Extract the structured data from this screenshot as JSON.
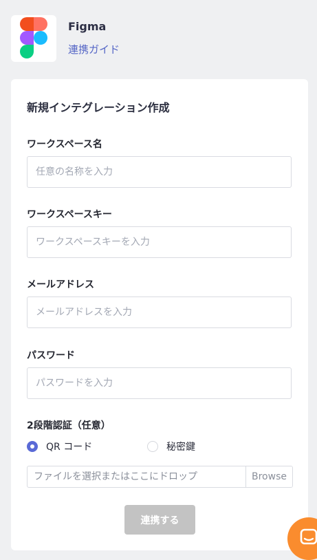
{
  "app": {
    "name": "Figma",
    "guide_link": "連携ガイド",
    "logo_colors": [
      "#f24e1e",
      "#ff7262",
      "#a259ff",
      "#1abcfe",
      "#0acf83"
    ]
  },
  "form": {
    "title": "新規インテグレーション作成",
    "fields": [
      {
        "label": "ワークスペース名",
        "placeholder": "任意の名称を入力",
        "value": ""
      },
      {
        "label": "ワークスペースキー",
        "placeholder": "ワークスペースキーを入力",
        "value": ""
      },
      {
        "label": "メールアドレス",
        "placeholder": "メールアドレスを入力",
        "value": ""
      },
      {
        "label": "パスワード",
        "placeholder": "パスワードを入力",
        "value": ""
      }
    ],
    "two_factor": {
      "label": "2段階認証（任意）",
      "options": [
        {
          "label": "QR コード",
          "selected": true
        },
        {
          "label": "秘密鍵",
          "selected": false
        }
      ]
    },
    "file_picker": {
      "placeholder": "ファイルを選択またはここにドロップ",
      "browse_label": "Browse"
    },
    "submit_label": "連携する"
  },
  "colors": {
    "accent": "#5a6ad6",
    "link": "#5566c6",
    "submit_disabled": "#c3c3c3",
    "chat_launcher": "#fa8c2e"
  },
  "chat_launcher": {
    "icon": "chat-bubble-icon"
  }
}
